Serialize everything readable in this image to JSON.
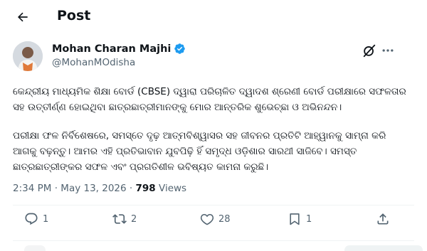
{
  "header": {
    "title": "Post",
    "back_icon": "arrow-left-icon"
  },
  "author": {
    "name": "Mohan Charan Majhi",
    "handle": "@MohanMOdisha",
    "verified_color": "#1d9bf0"
  },
  "tweet": {
    "paragraphs": [
      "କେନ୍ଦ୍ରୀୟ ମାଧ୍ୟମିକ ଶିକ୍ଷା ବୋର୍ଡ (CBSE) ଦ୍ୱାରା ପରିଚାଳିତ ଦ୍ୱାଦଶ ଶ୍ରେଣୀ ବୋର୍ଡ ପରୀକ୍ଷାରେ ସଫଳତାର ସହ ଉତ୍ତୀର୍ଣ୍ଣ ହୋଇଥିବା ଛାତ୍ରଛାତ୍ରୀମାନଙ୍କୁ ମୋର ଆନ୍ତରିକ ଶୁଭେଚ୍ଛା ଓ ଅଭିନନ୍ଦନ।",
      "ପରୀକ୍ଷା ଫଳ ନିର୍ବିଶେଷରେ, ସମସ୍ତେ ଦୃଢ଼ ଆତ୍ମବିଶ୍ୱାସର ସହ ଜୀବନର ପ୍ରତିଟି ଆହ୍ୱାନକୁ ସାମ୍ନା କରି ଆଗକୁ ବଢ଼ନ୍ତୁ। ଆମର ଏହି ପ୍ରତିଭାବାନ ଯୁବପିଢ଼ି ହିଁ ସମୃଦ୍ଧ ଓଡ଼ିଶାର ସାରଥୀ ସାଜିବେ। ସମସ୍ତ ଛାତ୍ରଛାତ୍ରୀଙ୍କର ସଫଳ ଏବଂ ପ୍ରଗତିଶୀଳ ଭବିଷ୍ୟତ କାମନା କରୁଛି।"
    ]
  },
  "meta": {
    "time": "2:34 PM",
    "separator": "·",
    "date": "May 13, 2026",
    "views_count": "798",
    "views_label": "Views"
  },
  "actions": {
    "reply": {
      "icon": "reply-icon",
      "count": "1"
    },
    "repost": {
      "icon": "repost-icon",
      "count": "2"
    },
    "like": {
      "icon": "heart-icon",
      "count": "28"
    },
    "bookmark": {
      "icon": "bookmark-icon",
      "count": "1"
    },
    "share": {
      "icon": "share-icon"
    }
  },
  "colors": {
    "text": "#0f1419",
    "secondary": "#536471",
    "accent": "#1d9bf0",
    "divider": "#eff3f4"
  }
}
